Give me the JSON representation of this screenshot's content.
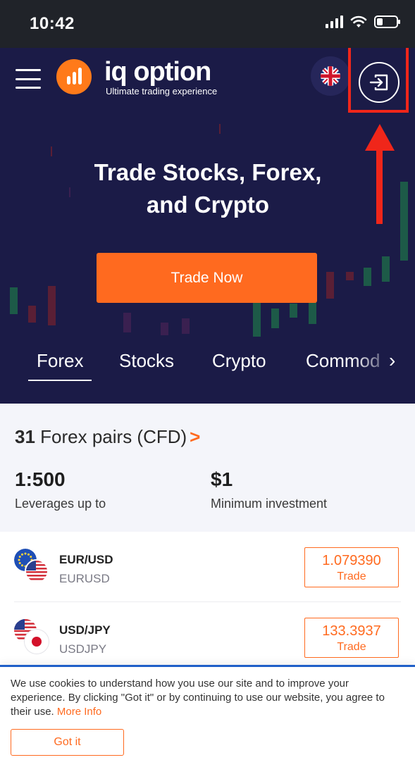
{
  "status_bar": {
    "time": "10:42",
    "icons": [
      "signal-icon",
      "wifi-icon",
      "battery-icon"
    ],
    "battery_level": 0.3
  },
  "header": {
    "menu_icon": "hamburger-menu-icon",
    "logo_name": "iq option",
    "logo_tagline": "Ultimate trading experience",
    "language_icon": "uk-flag-icon",
    "login_icon": "login-icon"
  },
  "hero": {
    "title_line1": "Trade Stocks, Forex,",
    "title_line2": "and Crypto",
    "cta_label": "Trade Now"
  },
  "tabs": [
    {
      "label": "Forex",
      "active": true
    },
    {
      "label": "Stocks",
      "active": false
    },
    {
      "label": "Crypto",
      "active": false
    },
    {
      "label": "Commod",
      "active": false
    }
  ],
  "stats": {
    "pairs_count": "31",
    "pairs_text": "Forex pairs (CFD)",
    "leverage_value": "1:500",
    "leverage_label": "Leverages up to",
    "min_invest_value": "$1",
    "min_invest_label": "Minimum investment"
  },
  "instruments": [
    {
      "name": "EUR/USD",
      "code": "EURUSD",
      "price": "1.079390",
      "trade_label": "Trade",
      "flags": [
        "eu-flag-icon",
        "us-flag-icon"
      ]
    },
    {
      "name": "USD/JPY",
      "code": "USDJPY",
      "price": "133.3937",
      "trade_label": "Trade",
      "flags": [
        "us-flag-icon",
        "japan-flag-icon"
      ]
    }
  ],
  "cookie": {
    "text": "We use cookies to understand how you use our site and to improve your experience. By clicking \"Got it\" or by continuing to use our website, you agree to their use.",
    "link_label": "More Info",
    "button_label": "Got it"
  },
  "colors": {
    "hero_bg": "#1b1b47",
    "accent": "#ff6a1f",
    "annotation_red": "#f0261a",
    "status_bar_bg": "#202329",
    "cookie_border": "#1f5fc8"
  }
}
